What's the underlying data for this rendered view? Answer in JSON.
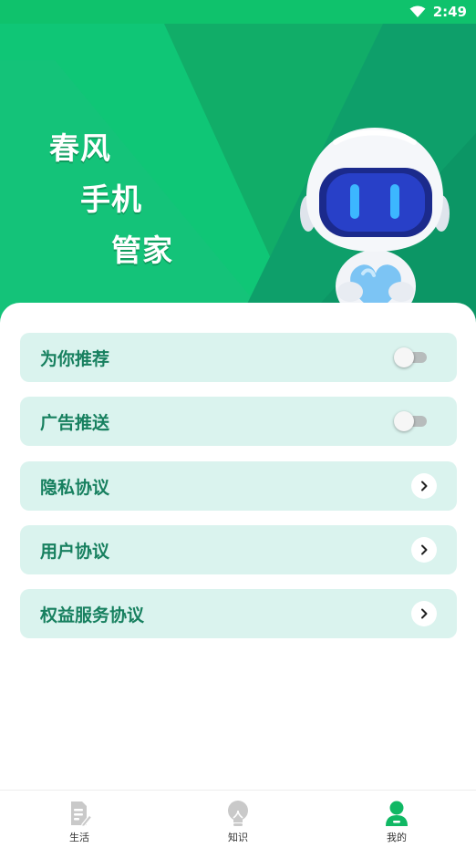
{
  "status_bar": {
    "time": "2:49"
  },
  "hero": {
    "slogan": [
      "春风",
      "手机",
      "管家"
    ]
  },
  "menu": [
    {
      "label": "为你推荐",
      "control": "toggle",
      "enabled": false
    },
    {
      "label": "广告推送",
      "control": "toggle",
      "enabled": false
    },
    {
      "label": "隐私协议",
      "control": "chevron"
    },
    {
      "label": "用户协议",
      "control": "chevron"
    },
    {
      "label": "权益服务协议",
      "control": "chevron"
    }
  ],
  "bottom_nav": [
    {
      "label": "生活",
      "icon": "document-edit-icon",
      "active": false
    },
    {
      "label": "知识",
      "icon": "lightbulb-icon",
      "active": false
    },
    {
      "label": "我的",
      "icon": "person-icon",
      "active": true
    }
  ],
  "colors": {
    "brand_green": "#12b86b",
    "menu_bg": "#daf3ee",
    "menu_text": "#17805f",
    "nav_active": "#10b864",
    "nav_inactive": "#c9c9c9"
  }
}
